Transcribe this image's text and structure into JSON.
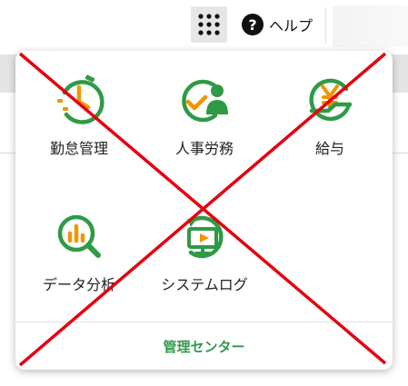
{
  "header": {
    "help_label": "ヘルプ",
    "help_glyph": "?",
    "launcher_icon": "grid-icon"
  },
  "panel": {
    "apps": [
      {
        "label": "勤怠管理",
        "icon": "attendance-clock-icon"
      },
      {
        "label": "人事労務",
        "icon": "hr-person-icon"
      },
      {
        "label": "給与",
        "icon": "payroll-yen-icon"
      },
      {
        "label": "データ分析",
        "icon": "analytics-magnifier-icon"
      },
      {
        "label": "システムログ",
        "icon": "system-log-monitor-icon"
      }
    ],
    "admin_center_label": "管理センター"
  },
  "colors": {
    "accent_green": "#2f9a46",
    "accent_orange": "#f29400",
    "cross_red": "#e4000f"
  }
}
